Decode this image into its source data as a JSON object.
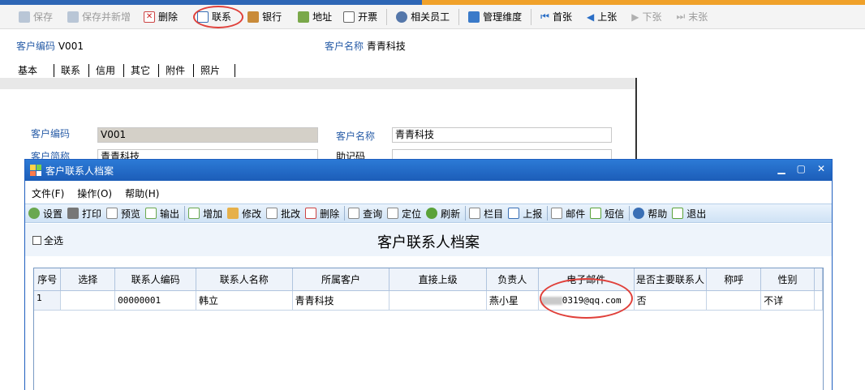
{
  "main_toolbar": {
    "save": "保存",
    "save_new": "保存并新增",
    "delete": "删除",
    "contact": "联系",
    "bank": "银行",
    "address": "地址",
    "invoice": "开票",
    "staff": "相关员工",
    "dimension": "管理维度",
    "first": "首张",
    "prev": "上张",
    "next": "下张",
    "last": "末张"
  },
  "header": {
    "code_label": "客户编码",
    "code_value": "V001",
    "name_label": "客户名称",
    "name_value": "青青科技"
  },
  "tabs": [
    "基本",
    "联系",
    "信用",
    "其它",
    "附件",
    "照片"
  ],
  "form": {
    "code_label": "客户编码",
    "code_value": "V001",
    "name_label": "客户名称",
    "name_value": "青青科技",
    "short_label": "客户简称",
    "short_value": "青青科技",
    "mnemonic_label": "助记码",
    "mnemonic_value": ""
  },
  "dialog": {
    "title": "客户联系人档案",
    "menu": [
      "文件(F)",
      "操作(O)",
      "帮助(H)"
    ],
    "toolbar": {
      "setup": "设置",
      "print": "打印",
      "preview": "预览",
      "export": "输出",
      "add": "增加",
      "edit": "修改",
      "batch_edit": "批改",
      "delete": "删除",
      "query": "查询",
      "locate": "定位",
      "refresh": "刷新",
      "columns": "栏目",
      "report": "上报",
      "mail": "邮件",
      "sms": "短信",
      "help": "帮助",
      "exit": "退出"
    },
    "select_all": "全选",
    "heading": "客户联系人档案",
    "columns": [
      "序号",
      "选择",
      "联系人编码",
      "联系人名称",
      "所属客户",
      "直接上级",
      "负责人",
      "电子邮件",
      "是否主要联系人",
      "称呼",
      "性别"
    ],
    "rows": [
      {
        "seq": "1",
        "select": "",
        "code": "00000001",
        "name": "韩立",
        "customer": "青青科技",
        "superior": "",
        "owner": "燕小星",
        "email": "0319@qq.com",
        "primary": "否",
        "title": "",
        "gender": "不详"
      }
    ]
  },
  "colors": {
    "title_bar": "#1c5db8",
    "highlight_circle": "#e0403a",
    "label_blue": "#2a5ea8"
  }
}
